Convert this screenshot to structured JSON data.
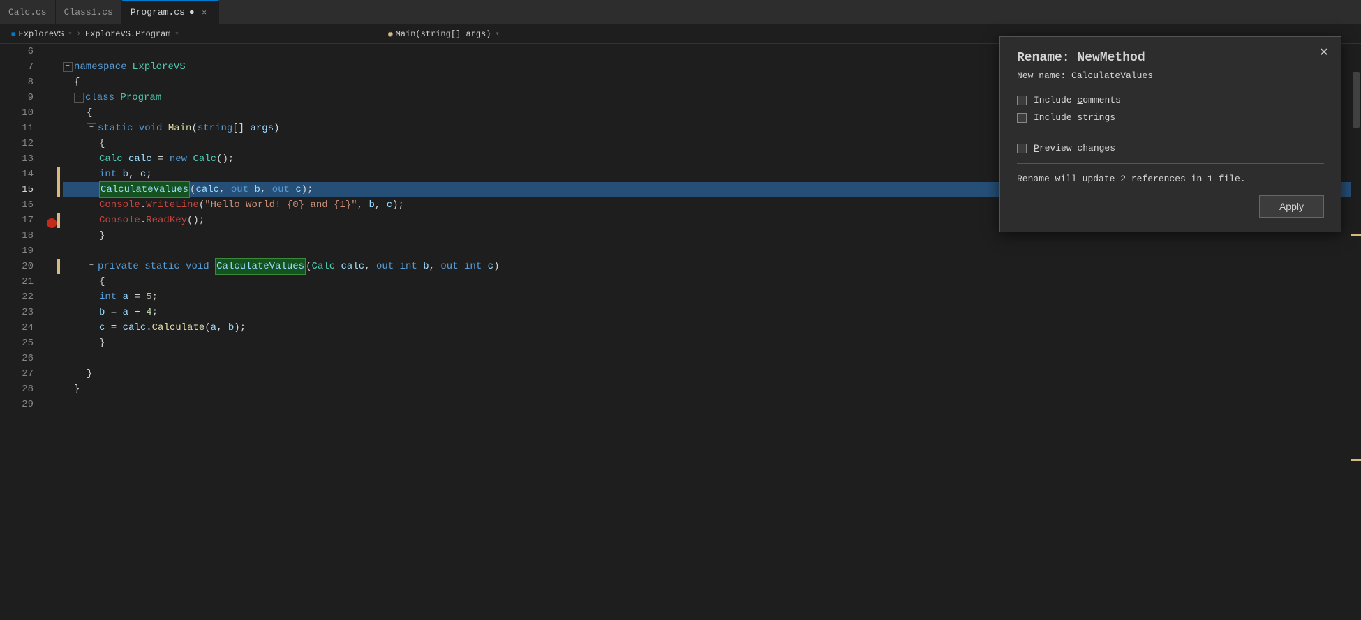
{
  "tabs": [
    {
      "label": "Calc.cs",
      "active": false,
      "modified": false
    },
    {
      "label": "Class1.cs",
      "active": false,
      "modified": false
    },
    {
      "label": "Program.cs",
      "active": true,
      "modified": true
    }
  ],
  "breadcrumb": {
    "left": {
      "icon": "◼",
      "items": [
        "ExploreVS",
        "▾",
        "ExploreVS.Program",
        "▾"
      ]
    },
    "right": {
      "icon": "◉",
      "items": [
        "Main(string[] args)",
        "▾"
      ]
    }
  },
  "rename_dialog": {
    "title": "Rename: NewMethod",
    "subtitle": "New name: CalculateValues",
    "options": [
      {
        "label": "Include comments",
        "underline_start": 8,
        "underline_char": "c"
      },
      {
        "label": "Include strings",
        "underline_start": 8,
        "underline_char": "s"
      }
    ],
    "preview_label": "Preview changes",
    "preview_underline": "P",
    "info": "Rename will update 2 references in 1 file.",
    "apply_label": "Apply",
    "close_label": "✕"
  },
  "code_lines": [
    {
      "num": 6,
      "content": ""
    },
    {
      "num": 7,
      "content": "namespace ExploreVS",
      "has_fold": true,
      "fold_open": true
    },
    {
      "num": 8,
      "content": "{",
      "indent": 0
    },
    {
      "num": 9,
      "content": "    class Program",
      "has_fold": true,
      "fold_open": true
    },
    {
      "num": 10,
      "content": "    {"
    },
    {
      "num": 11,
      "content": "        static void Main(string[] args)",
      "has_fold": true,
      "fold_open": true
    },
    {
      "num": 12,
      "content": "        {"
    },
    {
      "num": 13,
      "content": "            Calc calc = new Calc();"
    },
    {
      "num": 14,
      "content": "            int b, c;",
      "yellow_bar": true
    },
    {
      "num": 15,
      "content": "            CalculateValues(calc, out b, out c);",
      "highlighted": true,
      "yellow_bar": true
    },
    {
      "num": 16,
      "content": "            Console.WriteLine(\"Hello World! {0} and {1}\", b, c);"
    },
    {
      "num": 17,
      "content": "            Console.ReadKey();",
      "yellow_bar": true
    },
    {
      "num": 18,
      "content": "        }"
    },
    {
      "num": 19,
      "content": ""
    },
    {
      "num": 20,
      "content": "        private static void CalculateValues(Calc calc, out int b, out int c)",
      "has_fold": true,
      "fold_open": true,
      "yellow_bar": true
    },
    {
      "num": 21,
      "content": "        {"
    },
    {
      "num": 22,
      "content": "            int a = 5;"
    },
    {
      "num": 23,
      "content": "            b = a + 4;"
    },
    {
      "num": 24,
      "content": "            c = calc.Calculate(a, b);"
    },
    {
      "num": 25,
      "content": "        }"
    },
    {
      "num": 26,
      "content": ""
    },
    {
      "num": 27,
      "content": "    }"
    },
    {
      "num": 28,
      "content": "}"
    },
    {
      "num": 29,
      "content": ""
    }
  ]
}
